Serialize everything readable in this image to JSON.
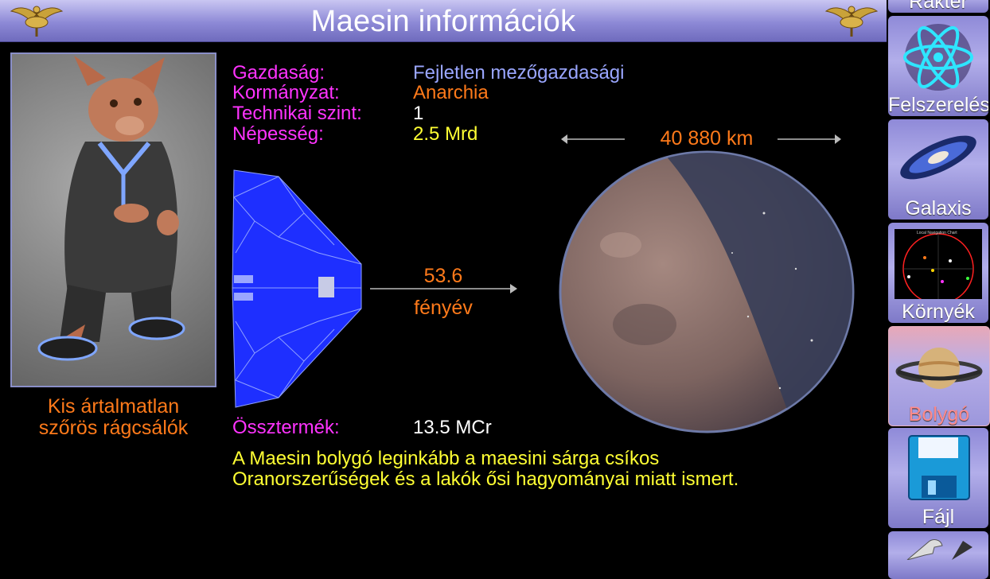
{
  "header": {
    "title": "Maesin információk"
  },
  "portrait": {
    "caption_line1": "Kis ártalmatlan",
    "caption_line2": "szőrös rágcsálók"
  },
  "info": {
    "economy_label": "Gazdaság:",
    "economy_value": "Fejletlen mezőgazdasági",
    "government_label": "Kormányzat:",
    "government_value": "Anarchia",
    "tech_label": "Technikai szint:",
    "tech_value": "1",
    "population_label": "Népesség:",
    "population_value": "2.5 Mrd",
    "production_label": "Össztermék:",
    "production_value": "13.5 MCr"
  },
  "distance": {
    "value": "53.6",
    "unit": "fényév"
  },
  "planet": {
    "diameter": "40 880 km"
  },
  "description": {
    "line1": "A Maesin bolygó leginkább a maesini sárga csíkos",
    "line2": "Oranorszerűségek és a lakók ősi hagyományai miatt ismert."
  },
  "sidebar": {
    "items": [
      {
        "label": "Rakter",
        "icon": "cargo-icon"
      },
      {
        "label": "Felszerelés",
        "icon": "atom-icon"
      },
      {
        "label": "Galaxis",
        "icon": "galaxy-icon"
      },
      {
        "label": "Környék",
        "icon": "local-chart-icon",
        "chart_title": "Local Navigation Chart"
      },
      {
        "label": "Bolygó",
        "icon": "saturn-icon"
      },
      {
        "label": "Fájl",
        "icon": "floppy-disk-icon"
      },
      {
        "label": "",
        "icon": "wrench-icon"
      }
    ]
  },
  "colors": {
    "label": "#ff33ff",
    "economy": "#9aa6ff",
    "government": "#ff7a1a",
    "tech": "#ffffff",
    "population": "#ffff33",
    "accent": "#ff7a1a",
    "description": "#ffff33"
  }
}
